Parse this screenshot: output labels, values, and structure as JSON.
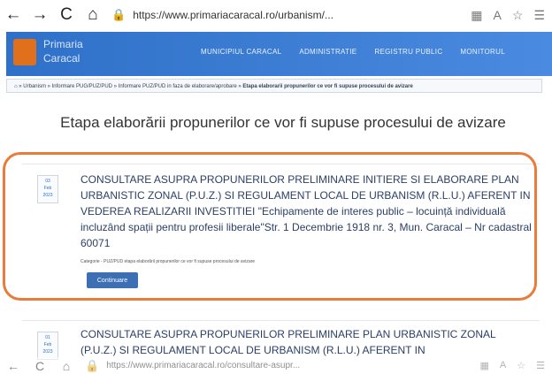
{
  "browser": {
    "back": "←",
    "forward": "→",
    "reload": "C",
    "home": "⌂",
    "url": "https://www.primariacaracal.ro/urbanism/...",
    "url_bottom": "https://www.primariacaracal.ro/consultare-asupr..."
  },
  "site": {
    "brand_line1": "Primaria",
    "brand_line2": "Caracal",
    "nav": [
      "MUNICIPIUL CARACAL",
      "ADMINISTRATIE",
      "REGISTRU PUBLIC",
      "MONITORUL"
    ]
  },
  "breadcrumb": {
    "path": "Urbanism » Informare PUG/PUZ/PUD » Informare PUZ/PUD in faza de elaborare/aprobare »",
    "current": "Etapa elaborarii propunerilor ce vor fi supuse procesului de avizare"
  },
  "page": {
    "title": "Etapa elaborării propunerilor ce vor fi supuse procesului de avizare"
  },
  "cards": [
    {
      "date_day": "03",
      "date_month": "Feb",
      "date_year": "2023",
      "title": "CONSULTARE ASUPRA PROPUNERILOR PRELIMINARE INITIERE SI ELABORARE PLAN URBANISTIC ZONAL (P.U.Z.) SI REGULAMENT LOCAL DE URBANISM (R.L.U.) AFERENT IN VEDEREA REALIZARII INVESTITIEI \"Echipamente de interes public – locuință individuală incluzând spații pentru profesii liberale\"Str. 1 Decembrie 1918 nr. 3, Mun. Caracal – Nr cadastral 60071",
      "category": "Categorie - PUZ/PUD etapa elaborării propunerilor ce vor fi supuse procesului de avizare",
      "button": "Continuare"
    },
    {
      "date_day": "01",
      "date_month": "Feb",
      "date_year": "2023",
      "title": "CONSULTARE ASUPRA PROPUNERILOR PRELIMINARE PLAN URBANISTIC ZONAL (P.U.Z.) SI REGULAMENT LOCAL DE URBANISM (R.L.U.) AFERENT IN"
    }
  ]
}
